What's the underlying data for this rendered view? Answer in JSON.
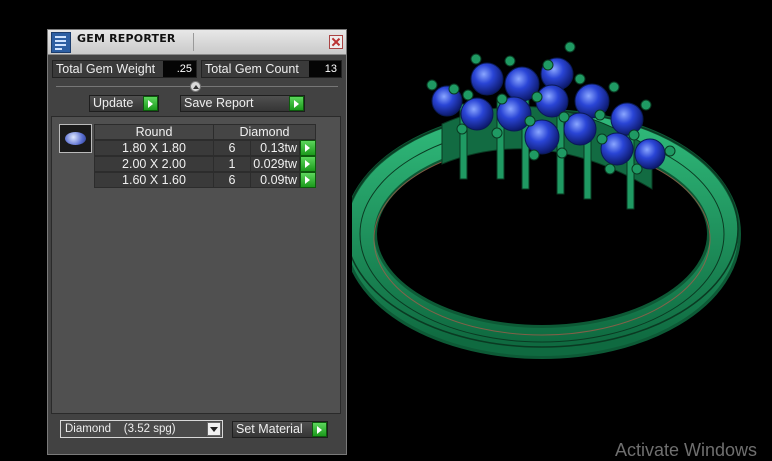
{
  "window": {
    "title": "GEM REPORTER"
  },
  "stats": {
    "total_weight_label": "Total Gem Weight",
    "total_weight_value": ".25",
    "total_count_label": "Total Gem Count",
    "total_count_value": "13"
  },
  "actions": {
    "update_label": "Update",
    "save_report_label": "Save Report",
    "set_material_label": "Set Material"
  },
  "table": {
    "shape_header": "Round",
    "material_header": "Diamond",
    "rows": [
      {
        "size": "1.80 X 1.80",
        "count": "6",
        "weight": "0.13tw"
      },
      {
        "size": "2.00 X 2.00",
        "count": "1",
        "weight": "0.029tw"
      },
      {
        "size": "1.60 X 1.60",
        "count": "6",
        "weight": "0.09tw"
      }
    ]
  },
  "material_select": {
    "selected": "Diamond    (3.52 spg)"
  },
  "viewport": {
    "model": "ring-with-gem-cluster",
    "metal_color": "#1f9a63",
    "gem_color": "#2a45d6"
  },
  "watermark": {
    "text": "Activate Windows"
  }
}
